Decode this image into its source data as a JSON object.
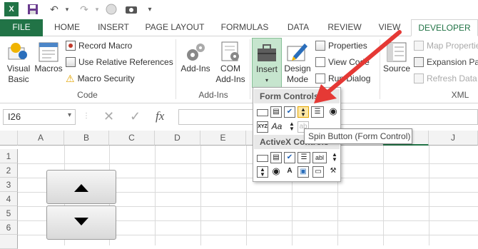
{
  "qat": {
    "icons": [
      "excel-logo-icon",
      "save-icon",
      "undo-icon",
      "redo-icon",
      "touch-mode-icon",
      "camera-icon",
      "customize-icon"
    ]
  },
  "tabs": [
    "FILE",
    "HOME",
    "INSERT",
    "PAGE LAYOUT",
    "FORMULAS",
    "DATA",
    "REVIEW",
    "VIEW",
    "DEVELOPER"
  ],
  "ribbon": {
    "code": {
      "visual_basic": "Visual\nBasic",
      "macros": "Macros",
      "record_macro": "Record Macro",
      "relative_refs": "Use Relative References",
      "macro_security": "Macro Security",
      "label": "Code"
    },
    "addins": {
      "addins": "Add-Ins",
      "com_addins": "COM\nAdd-Ins",
      "label": "Add-Ins"
    },
    "controls": {
      "insert": "Insert",
      "design_mode": "Design\nMode",
      "properties": "Properties",
      "view_code": "View Code",
      "run_dialog": "Run Dialog"
    },
    "xml": {
      "source": "Source",
      "map_properties": "Map Properties",
      "expansion_packs": "Expansion Packs",
      "refresh_data": "Refresh Data",
      "label": "XML"
    }
  },
  "formula_bar": {
    "name_box": "I26",
    "fx": "fx",
    "cancel": "✕",
    "enter": "✓"
  },
  "grid": {
    "columns": [
      "A",
      "B",
      "C",
      "D",
      "E",
      "F",
      "G",
      "H",
      "I",
      "J"
    ],
    "rows": [
      "1",
      "2",
      "3",
      "4",
      "5",
      "6"
    ]
  },
  "dropdown": {
    "form_header": "Form Controls",
    "activex_header": "ActiveX Controls"
  },
  "tooltip": "Spin Button (Form Control)",
  "colors": {
    "excel_green": "#217346",
    "arrow_red": "#e53935"
  }
}
